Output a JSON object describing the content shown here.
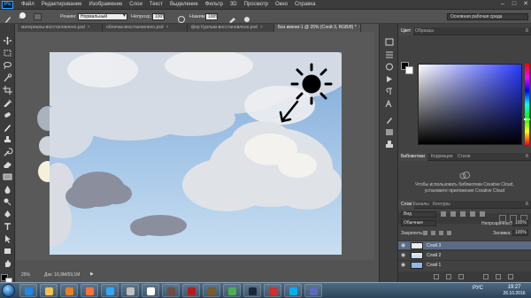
{
  "menubar": {
    "logo": "Ps",
    "items": [
      "Файл",
      "Редактирование",
      "Изображение",
      "Слои",
      "Текст",
      "Выделение",
      "Фильтр",
      "3D",
      "Просмотр",
      "Окно",
      "Справка"
    ],
    "controls": [
      "–",
      "□",
      "✕"
    ]
  },
  "options": {
    "brush_size": "40",
    "mode_label": "Режим:",
    "mode_value": "Нормальный",
    "opacity_label": "Непрозр.:",
    "opacity_value": "100%",
    "flow_label": "Нажим:",
    "flow_value": "100%",
    "workspace": "Основная рабочая среда"
  },
  "tabs": [
    {
      "label": "материалы-восстановлено.psd",
      "active": false
    },
    {
      "label": "облачка-восстановлено.psd",
      "active": false
    },
    {
      "label": "фор Курлым-восстановлено.psd",
      "active": false
    },
    {
      "label": "Без имени-1 @ 25% (Слой 3, RGB/8) *",
      "active": true
    }
  ],
  "status": {
    "zoom": "25%",
    "doc": "Док: 16,9M/59,1M"
  },
  "panels": {
    "color_tabs": [
      "Цвет",
      "Образцы"
    ],
    "library_tabs": [
      "Библиотеки",
      "Коррекция",
      "Стили"
    ],
    "library_message": "Чтобы использовать библиотеки Creative Cloud, установите приложение Creative Cloud",
    "layers_tabs": [
      "Слои",
      "Каналы",
      "Контуры"
    ],
    "filter_kind": "Вид",
    "blend_mode": "Обычные",
    "opacity_label": "Непрозрачность:",
    "opacity_value": "100%",
    "lock_label": "Закрепить:",
    "fill_label": "Заливка:",
    "fill_value": "100%",
    "layers": [
      {
        "name": "Слой 3",
        "selected": true
      },
      {
        "name": "Слой 2",
        "selected": false
      },
      {
        "name": "Слой 1",
        "selected": false
      }
    ]
  },
  "taskbar": {
    "lang": "РУС",
    "time": "19:27",
    "date": "26.10.2016",
    "apps": [
      {
        "name": "ie-icon",
        "color": "#1e88e5"
      },
      {
        "name": "folder-icon",
        "color": "#f2c14e"
      },
      {
        "name": "media-player-icon",
        "color": "#e67e22"
      },
      {
        "name": "firefox-icon",
        "color": "#ff7139"
      },
      {
        "name": "photoshop-icon",
        "color": "#31a8ff"
      },
      {
        "name": "app-icon",
        "color": "#c0c0c0"
      },
      {
        "name": "m-app-icon",
        "color": "#ffffff"
      },
      {
        "name": "app2-icon",
        "color": "#6d4c41"
      },
      {
        "name": "bug-icon",
        "color": "#b71c1c"
      },
      {
        "name": "game-icon",
        "color": "#7a5b2a"
      },
      {
        "name": "chrome-icon",
        "color": "#4caf50"
      },
      {
        "name": "steam-icon",
        "color": "#1b2838"
      },
      {
        "name": "flag-icon",
        "color": "#d32f2f"
      },
      {
        "name": "skype-icon",
        "color": "#00aff0"
      },
      {
        "name": "app3-icon",
        "color": "#5c6bc0"
      }
    ]
  }
}
